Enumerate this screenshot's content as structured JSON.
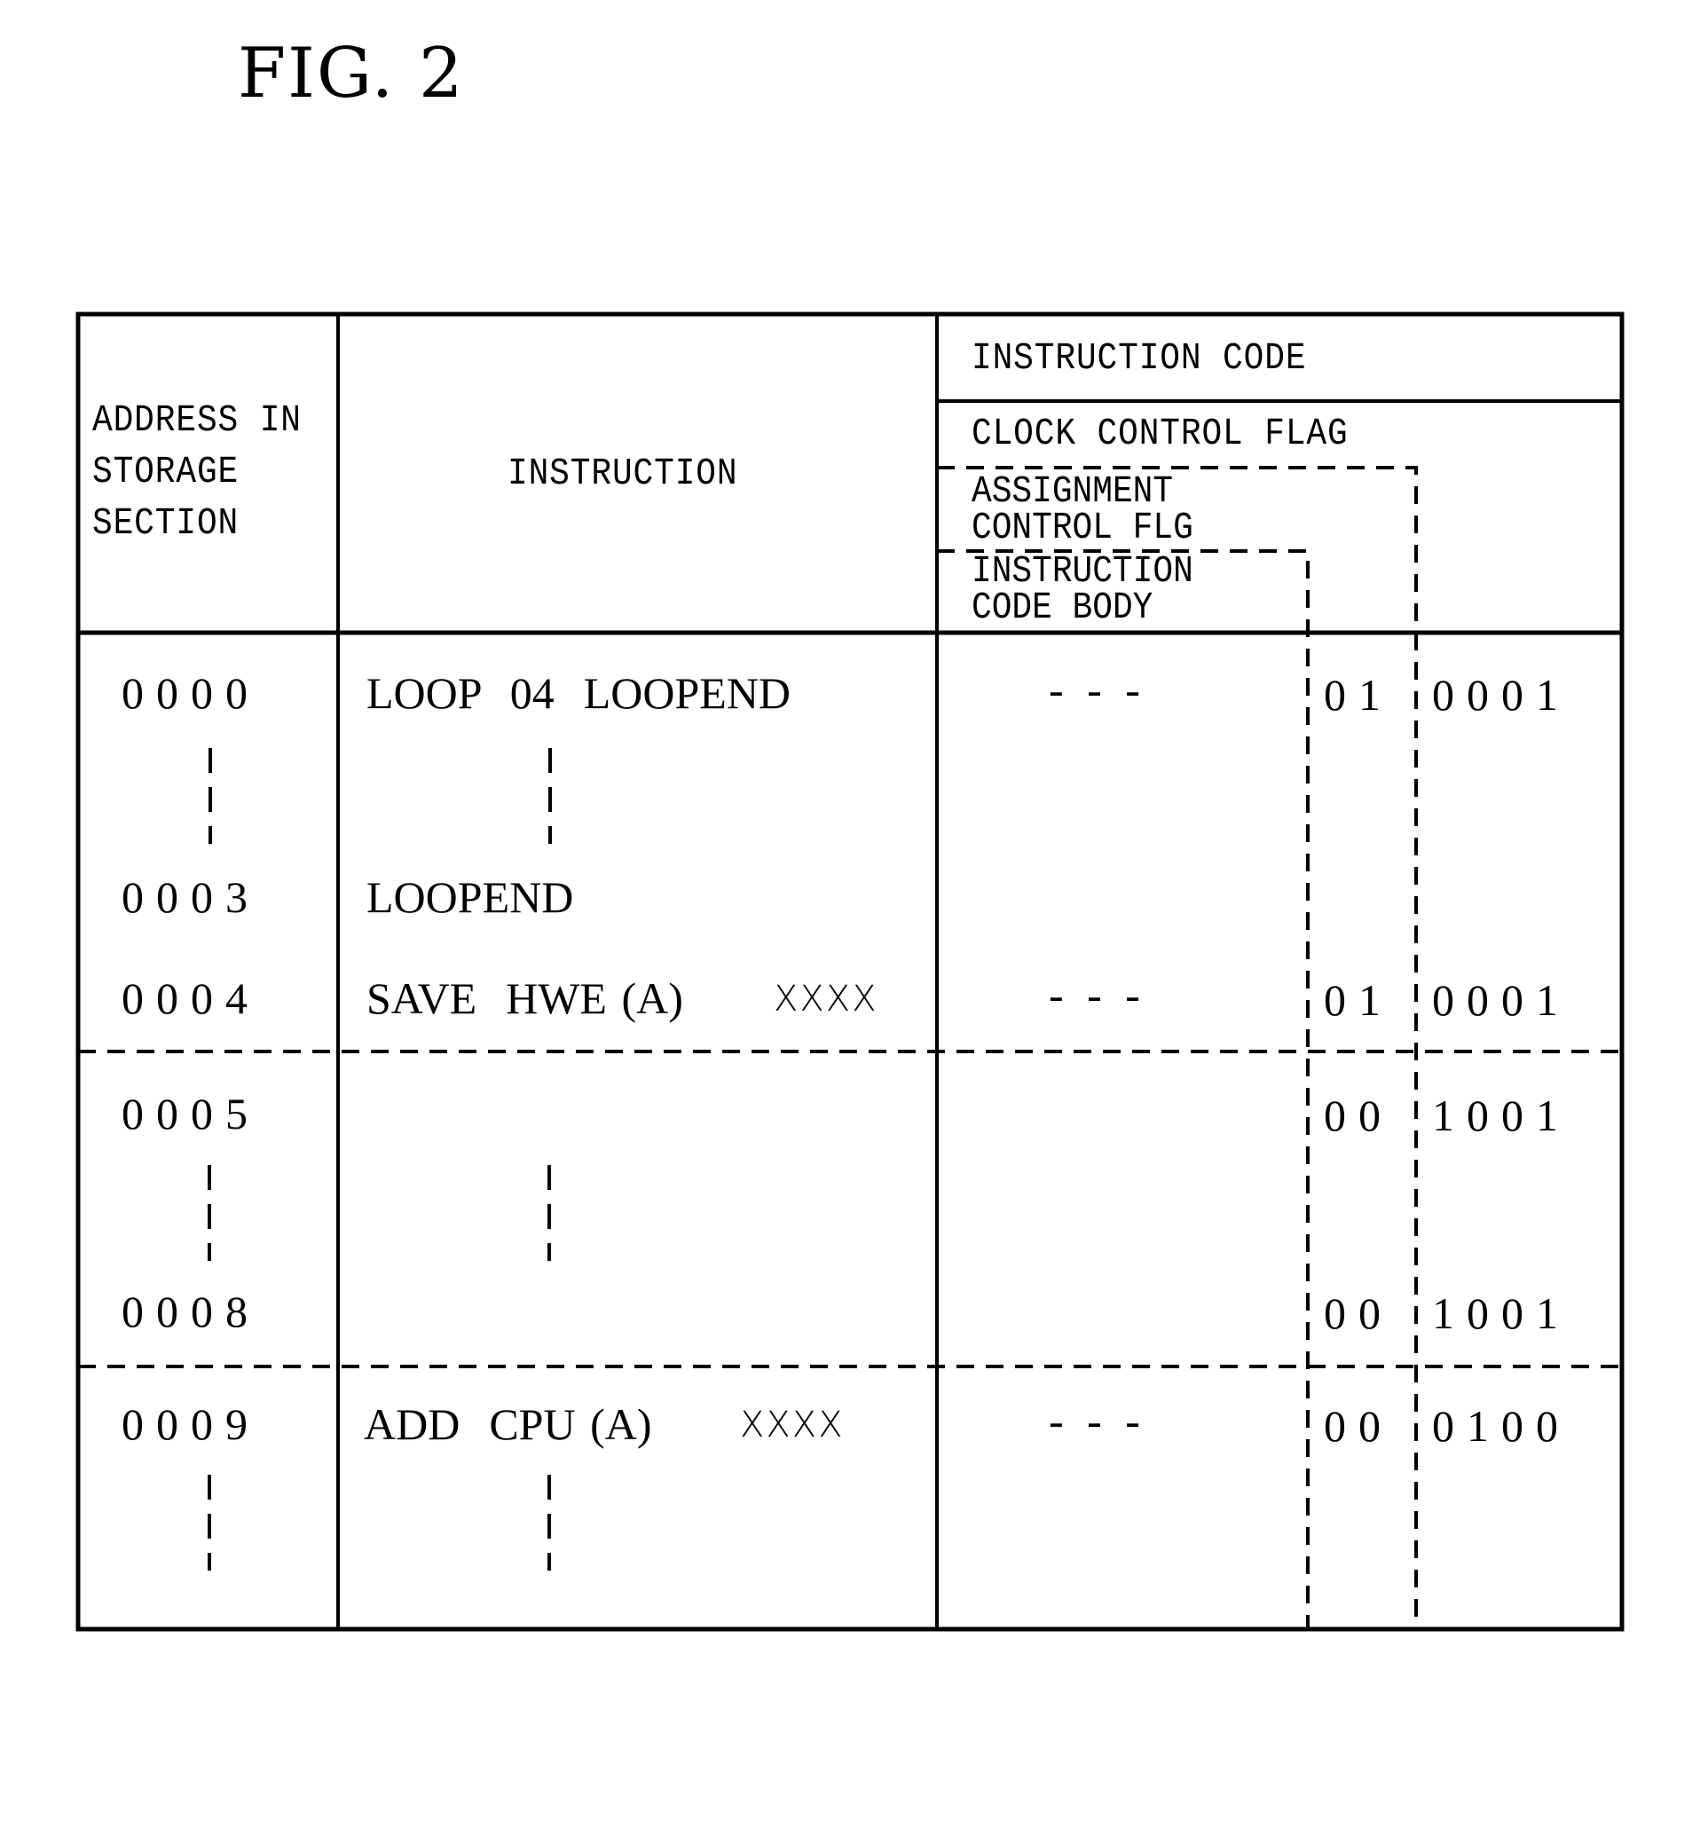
{
  "figure": {
    "label": "FIG. 2"
  },
  "headers": {
    "address": [
      "ADDRESS IN",
      "STORAGE",
      "SECTION"
    ],
    "instruction": "INSTRUCTION",
    "instruction_code": "INSTRUCTION CODE",
    "clock_control_flag": "CLOCK CONTROL FLAG",
    "assignment_control_flag": [
      "ASSIGNMENT",
      "CONTROL FLG"
    ],
    "instruction_code_body": [
      "INSTRUCTION",
      "CODE BODY"
    ]
  },
  "rows": [
    {
      "address": "0000",
      "instruction": "LOOP  04  LOOPEND",
      "operand": "",
      "code_body": "- - -",
      "assignment_flag": "01",
      "clock_flag": "0001"
    },
    {
      "address": "0003",
      "instruction": "LOOPEND",
      "operand": "",
      "code_body": "",
      "assignment_flag": "",
      "clock_flag": ""
    },
    {
      "address": "0004",
      "instruction": "SAVE  HWE (A)",
      "operand": "XXXX",
      "code_body": "- - -",
      "assignment_flag": "01",
      "clock_flag": "0001"
    },
    {
      "address": "0005",
      "instruction": "",
      "operand": "",
      "code_body": "",
      "assignment_flag": "00",
      "clock_flag": "1001"
    },
    {
      "address": "0008",
      "instruction": "",
      "operand": "",
      "code_body": "",
      "assignment_flag": "00",
      "clock_flag": "1001"
    },
    {
      "address": "0009",
      "instruction": "ADD  CPU (A)",
      "operand": "XXXX",
      "code_body": "- - -",
      "assignment_flag": "00",
      "clock_flag": "0100"
    }
  ],
  "ellipsis_marker": "vertical-dashes"
}
